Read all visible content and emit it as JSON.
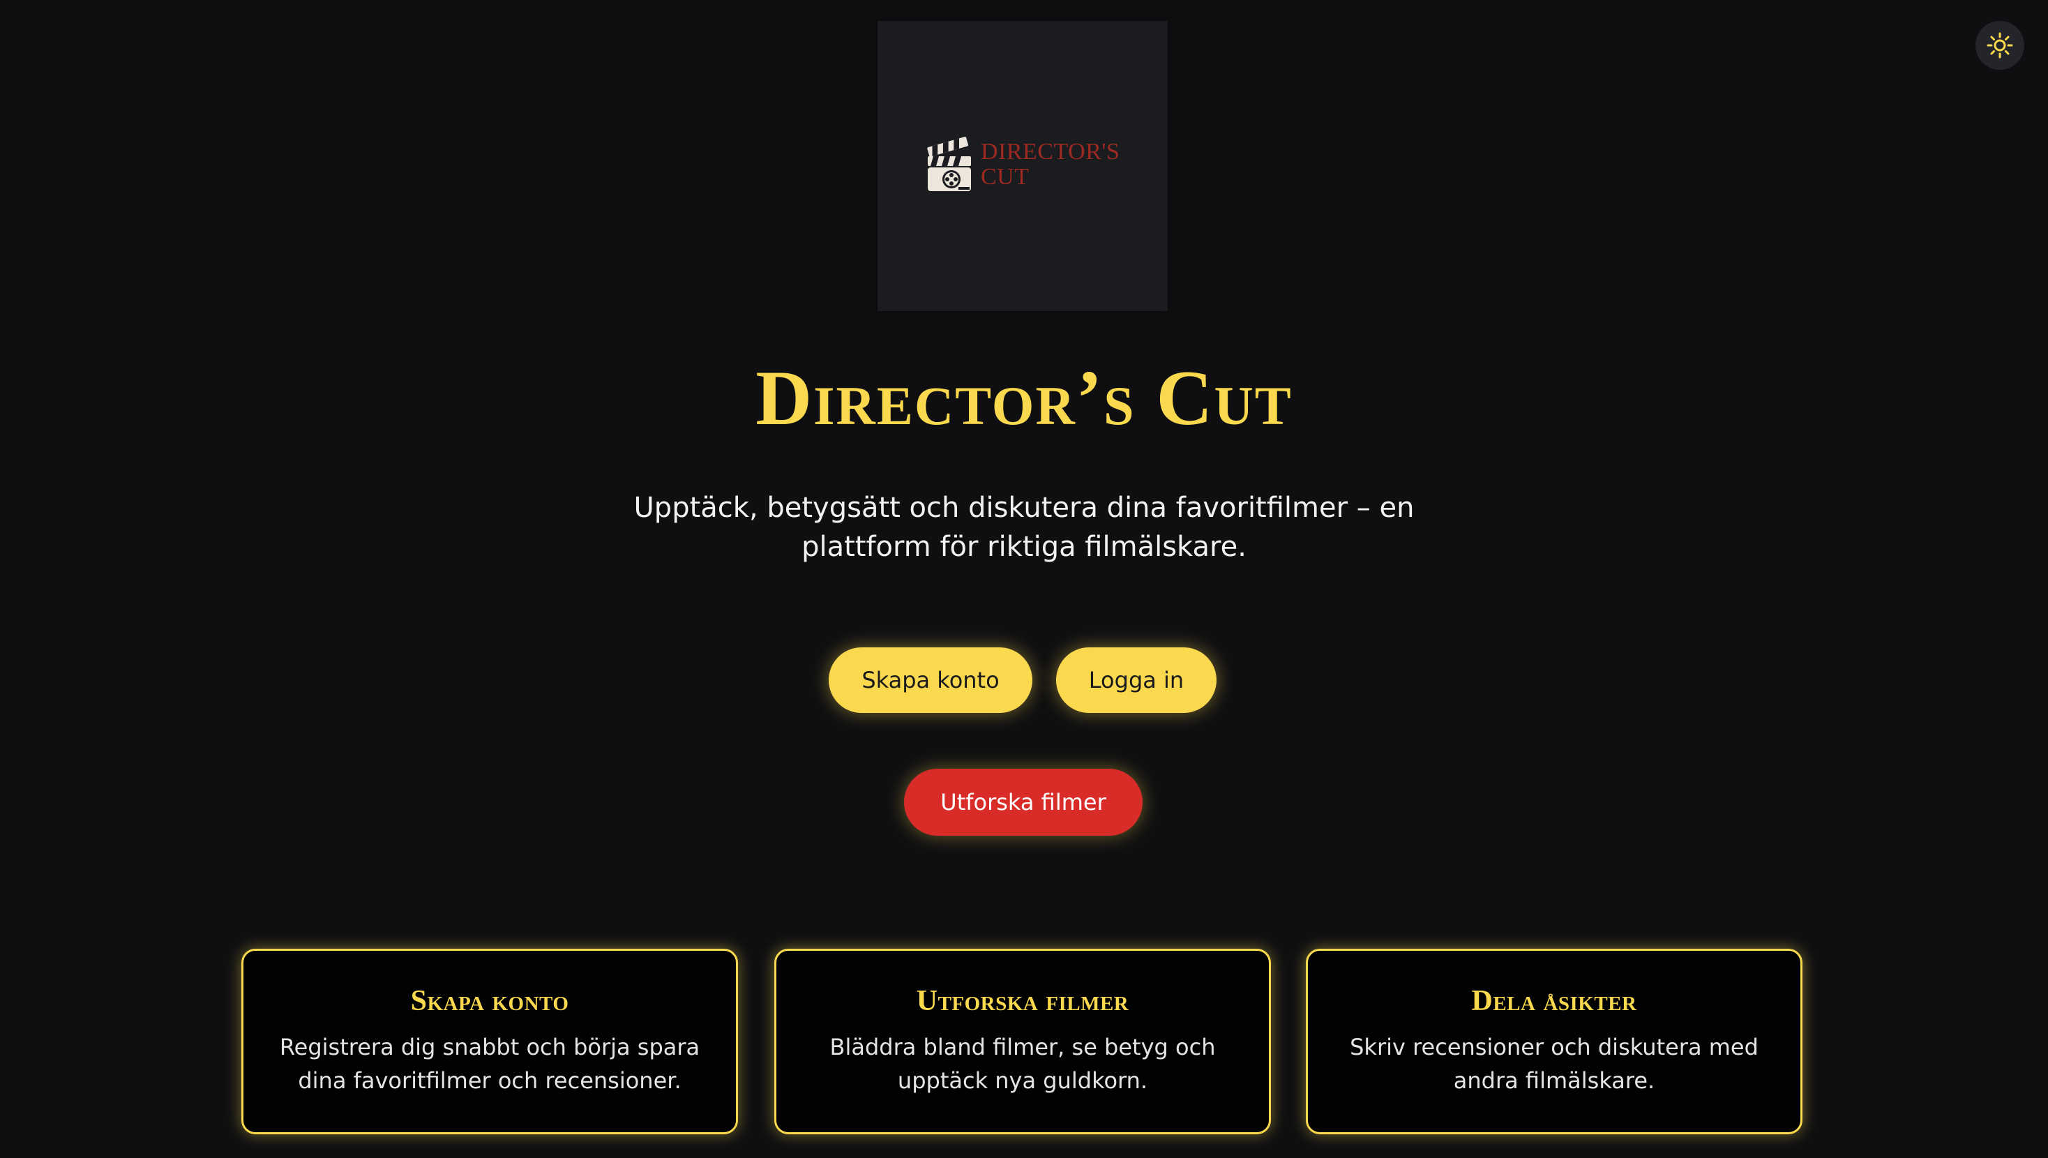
{
  "theme_toggle": {
    "icon": "sun-icon"
  },
  "logo": {
    "icon": "clapperboard-icon",
    "line1": "DIRECTOR'S",
    "line2": "CUT",
    "text_color": "#9c2a22"
  },
  "hero": {
    "title": "Director’s Cut",
    "subtitle": "Upptäck, betygsätt och diskutera dina favoritfilmer – en plattform för riktiga filmälskare."
  },
  "actions": {
    "signup_label": "Skapa konto",
    "login_label": "Logga in",
    "explore_label": "Utforska filmer"
  },
  "features": [
    {
      "title": "Skapa konto",
      "text": "Registrera dig snabbt och börja spara dina favoritfilmer och recensioner."
    },
    {
      "title": "Utforska filmer",
      "text": "Bläddra bland filmer, se betyg och upptäck nya guldkorn."
    },
    {
      "title": "Dela åsikter",
      "text": "Skriv recensioner och diskutera med andra filmälskare."
    }
  ],
  "colors": {
    "background": "#0f0f11",
    "accent": "#fbd94f",
    "danger": "#d92b27"
  }
}
